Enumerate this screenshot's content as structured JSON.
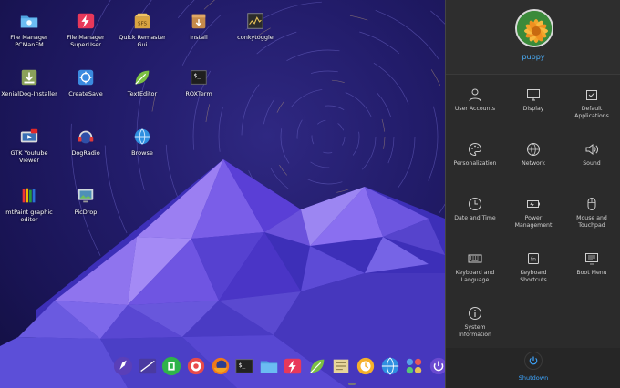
{
  "desktop": {
    "icons": [
      {
        "label": "File Manager PCManFM",
        "icon": "folder-icon"
      },
      {
        "label": "File Manager SuperUser",
        "icon": "superuser-folder-icon"
      },
      {
        "label": "Quick Remaster Gui",
        "icon": "sfs-package-icon"
      },
      {
        "label": "Install",
        "icon": "install-box-icon"
      },
      {
        "label": "conkytoggle",
        "icon": "conky-chart-icon"
      },
      {
        "label": "XenialDog-Installer",
        "icon": "installer-icon"
      },
      {
        "label": "CreateSave",
        "icon": "save-icon"
      },
      {
        "label": "TextEditor",
        "icon": "leaf-editor-icon"
      },
      {
        "label": "ROXTerm",
        "icon": "terminal-icon"
      },
      {
        "label": "GTK Youtube Viewer",
        "icon": "youtube-viewer-icon"
      },
      {
        "label": "DogRadio",
        "icon": "radio-headphones-icon"
      },
      {
        "label": "Browse",
        "icon": "globe-icon"
      },
      {
        "label": "mtPaint graphic editor",
        "icon": "paint-pencils-icon"
      },
      {
        "label": "PicDrop",
        "icon": "picture-monitor-icon"
      }
    ]
  },
  "taskbar": {
    "items": [
      "rocket-launcher-icon",
      "window-manager-icon",
      "puppy-icon",
      "settings-gear-icon",
      "firefox-icon",
      "terminal-icon",
      "folder-icon",
      "superuser-icon",
      "leaf-editor-icon",
      "notes-icon",
      "update-icon",
      "network-globe-icon",
      "apps-grid-icon",
      "power-icon"
    ]
  },
  "panel": {
    "user_name": "puppy",
    "tiles": [
      {
        "label": "User Accounts",
        "icon": "user-icon"
      },
      {
        "label": "Display",
        "icon": "monitor-icon"
      },
      {
        "label": "Default Applications",
        "icon": "default-apps-icon"
      },
      {
        "label": "Personalization",
        "icon": "palette-icon"
      },
      {
        "label": "Network",
        "icon": "network-icon"
      },
      {
        "label": "Sound",
        "icon": "speaker-icon"
      },
      {
        "label": "Date and Time",
        "icon": "clock-icon"
      },
      {
        "label": "Power Management",
        "icon": "battery-icon"
      },
      {
        "label": "Mouse and Touchpad",
        "icon": "mouse-icon"
      },
      {
        "label": "Keyboard and Language",
        "icon": "keyboard-icon"
      },
      {
        "label": "Keyboard Shortcuts",
        "icon": "shortcut-key-icon"
      },
      {
        "label": "Boot Menu",
        "icon": "boot-menu-icon"
      },
      {
        "label": "System Information",
        "icon": "info-icon"
      }
    ],
    "shutdown_label": "Shutdown"
  },
  "colors": {
    "panel_bg": "#2b2b2b",
    "accent_blue": "#3ea6ff",
    "wallpaper_purple": "#221c6a"
  }
}
